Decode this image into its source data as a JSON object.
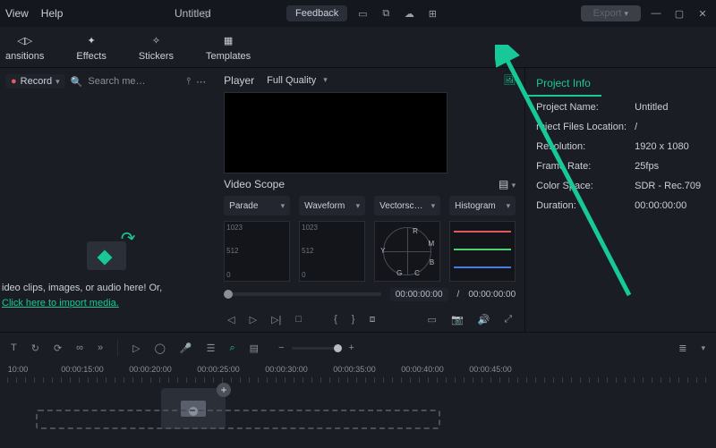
{
  "titlebar": {
    "view": "View",
    "help": "Help",
    "doc": "Untitled",
    "feedback": "Feedback",
    "export": "Export"
  },
  "tools": {
    "transitions": "ansitions",
    "effects": "Effects",
    "stickers": "Stickers",
    "templates": "Templates"
  },
  "media": {
    "record": "Record",
    "search_ph": "Search me…",
    "import1": "ideo clips, images, or audio here! Or,",
    "import2": "Click here to import media."
  },
  "player": {
    "label": "Player",
    "quality": "Full Quality"
  },
  "scope": {
    "title": "Video Scope",
    "parade": "Parade",
    "waveform": "Waveform",
    "vector": "Vectorsc…",
    "histogram": "Histogram",
    "v1023": "1023",
    "v512": "512",
    "v0": "0",
    "R": "R",
    "M": "M",
    "B": "B",
    "G": "G",
    "C": "C",
    "Y": "Y"
  },
  "playback": {
    "cur": "00:00:00:00",
    "sep": "/",
    "total": "00:00:00:00"
  },
  "info": {
    "tab": "Project Info",
    "k1": "Project Name:",
    "v1": "Untitled",
    "k2": "roject Files Location:",
    "v2": "/",
    "k3": "Resolution:",
    "v3": "1920 x 1080",
    "k4": "Frame Rate:",
    "v4": "25fps",
    "k5": "Color Space:",
    "v5": "SDR - Rec.709",
    "k6": "Duration:",
    "v6": "00:00:00:00"
  },
  "ruler": {
    "t1": "10:00",
    "t2": "00:00:15:00",
    "t3": "00:00:20:00",
    "t4": "00:00:25:00",
    "t5": "00:00:30:00",
    "t6": "00:00:35:00",
    "t7": "00:00:40:00",
    "t8": "00:00:45:00"
  },
  "icons": {
    "caret": "▾",
    "plus": "+",
    "minus": "−",
    "ellipsis": "⋯",
    "more": "»"
  }
}
